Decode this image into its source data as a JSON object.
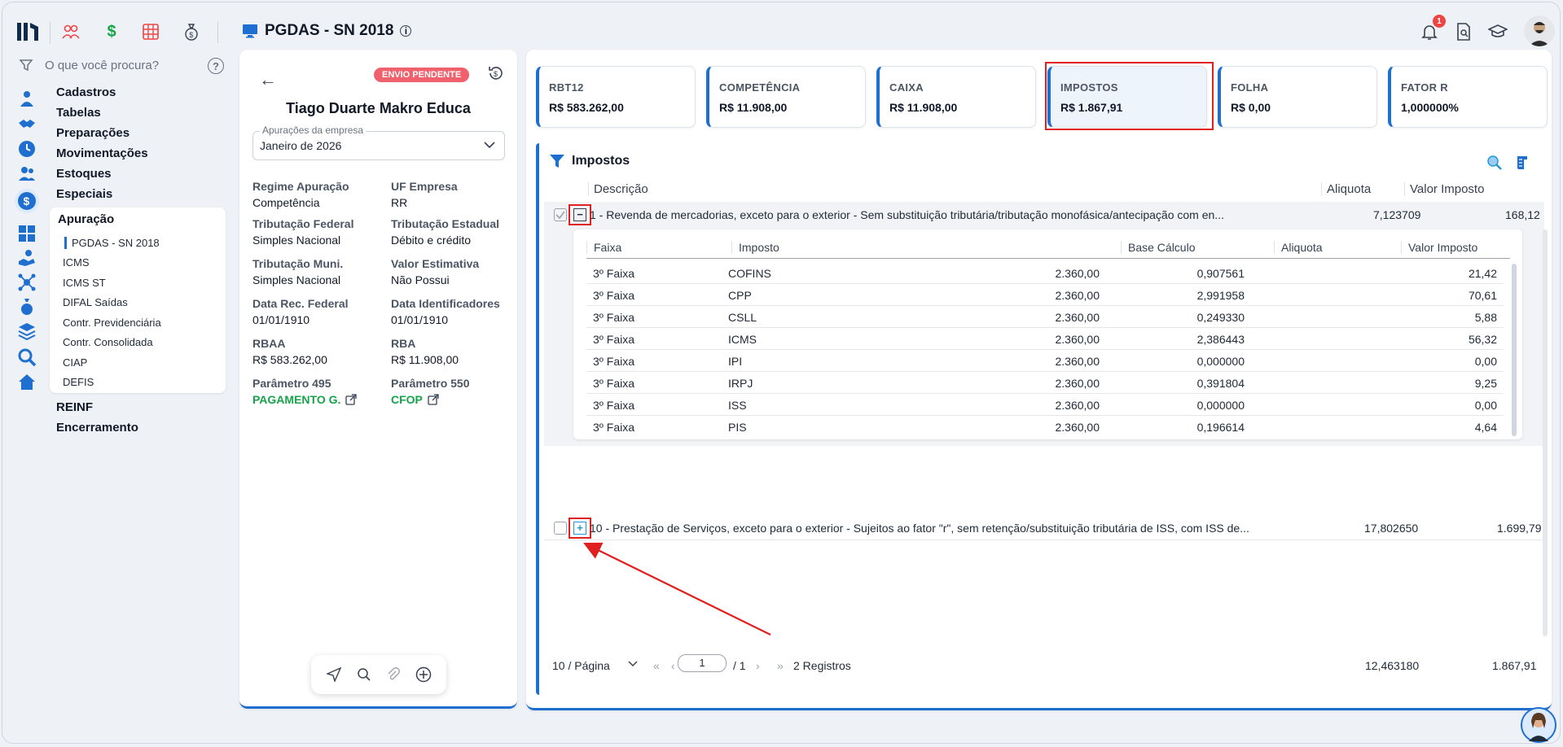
{
  "header": {
    "title": "PGDAS - SN 2018",
    "notification_count": "1"
  },
  "sidebar": {
    "search_placeholder": "O que você procura?",
    "menu": [
      "Cadastros",
      "Tabelas",
      "Preparações",
      "Movimentações",
      "Estoques",
      "Especiais"
    ],
    "apuracao": {
      "label": "Apuração",
      "items": [
        "PGDAS - SN 2018",
        "ICMS",
        "ICMS ST",
        "DIFAL Saídas",
        "Contr. Previdenciária",
        "Contr. Consolidada",
        "CIAP",
        "DEFIS"
      ]
    },
    "menu_after": [
      "REINF",
      "Encerramento"
    ]
  },
  "company": {
    "status": "ENVIO PENDENTE",
    "name": "Tiago Duarte Makro Educa",
    "select_label": "Apurações da empresa",
    "select_value": "Janeiro de 2026",
    "fields": [
      {
        "k": "Regime Apuração",
        "v": "Competência"
      },
      {
        "k": "UF Empresa",
        "v": "RR"
      },
      {
        "k": "Tributação Federal",
        "v": "Simples Nacional"
      },
      {
        "k": "Tributação Estadual",
        "v": "Débito e crédito"
      },
      {
        "k": "Tributação Muni.",
        "v": "Simples Nacional"
      },
      {
        "k": "Valor Estimativa",
        "v": "Não Possui"
      },
      {
        "k": "Data Rec. Federal",
        "v": "01/01/1910"
      },
      {
        "k": "Data Identificadores",
        "v": "01/01/1910"
      },
      {
        "k": "RBAA",
        "v": "R$ 583.262,00"
      },
      {
        "k": "RBA",
        "v": "R$ 11.908,00"
      },
      {
        "k": "Parâmetro 495",
        "v": "PAGAMENTO G."
      },
      {
        "k": "Parâmetro 550",
        "v": "CFOP"
      }
    ]
  },
  "cards": [
    {
      "k": "RBT12",
      "v": "R$ 583.262,00"
    },
    {
      "k": "COMPETÊNCIA",
      "v": "R$ 11.908,00"
    },
    {
      "k": "CAIXA",
      "v": "R$ 11.908,00"
    },
    {
      "k": "IMPOSTOS",
      "v": "R$ 1.867,91"
    },
    {
      "k": "FOLHA",
      "v": "R$ 0,00"
    },
    {
      "k": "FATOR R",
      "v": "1,000000%"
    }
  ],
  "table": {
    "title": "Impostos",
    "columns": [
      "Descrição",
      "Aliquota",
      "Valor Imposto"
    ],
    "rows": [
      {
        "descricao": "1 - Revenda de mercadorias, exceto para o exterior - Sem substituição tributária/tributação monofásica/antecipação com en...",
        "aliquota": "7,123709",
        "valor": "168,12",
        "expand": "−"
      },
      {
        "descricao": "10 - Prestação de Serviços, exceto para o exterior - Sujeitos ao fator \"r\", sem retenção/substituição tributária de ISS, com ISS de...",
        "aliquota": "17,802650",
        "valor": "1.699,79",
        "expand": "+"
      }
    ],
    "detail_columns": [
      "Faixa",
      "Imposto",
      "Base Cálculo",
      "Aliquota",
      "Valor Imposto"
    ],
    "detail_rows": [
      [
        "3º Faixa",
        "COFINS",
        "2.360,00",
        "0,907561",
        "21,42"
      ],
      [
        "3º Faixa",
        "CPP",
        "2.360,00",
        "2,991958",
        "70,61"
      ],
      [
        "3º Faixa",
        "CSLL",
        "2.360,00",
        "0,249330",
        "5,88"
      ],
      [
        "3º Faixa",
        "ICMS",
        "2.360,00",
        "2,386443",
        "56,32"
      ],
      [
        "3º Faixa",
        "IPI",
        "2.360,00",
        "0,000000",
        "0,00"
      ],
      [
        "3º Faixa",
        "IRPJ",
        "2.360,00",
        "0,391804",
        "9,25"
      ],
      [
        "3º Faixa",
        "ISS",
        "2.360,00",
        "0,000000",
        "0,00"
      ],
      [
        "3º Faixa",
        "PIS",
        "2.360,00",
        "0,196614",
        "4,64"
      ]
    ],
    "pager": {
      "page_size": "10 / Página",
      "page": "1",
      "total_pages": "/ 1",
      "records": "2 Registros",
      "sum_aliquota": "12,463180",
      "sum_valor": "1.867,91"
    }
  },
  "colors": {
    "accent": "#1f6fd1",
    "pending": "#f0616d",
    "highlight": "#e02020",
    "green": "#16a34a"
  }
}
